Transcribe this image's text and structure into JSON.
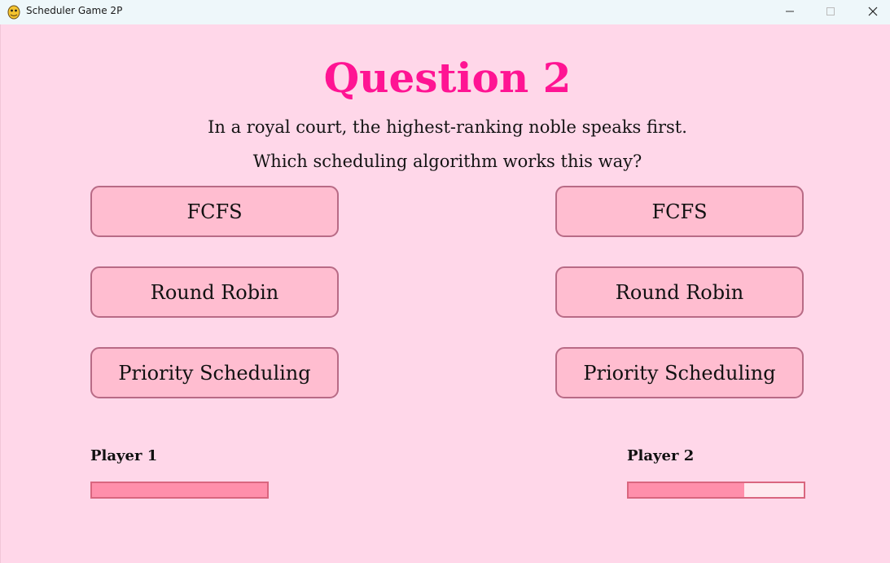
{
  "window": {
    "title": "Scheduler Game 2P",
    "app_icon": "pygame-snake-icon",
    "controls": [
      "minimize-icon",
      "maximize-icon",
      "close-icon"
    ]
  },
  "question": {
    "title": "Question 2",
    "line1": "In a royal court, the highest-ranking noble speaks first.",
    "line2": "Which scheduling algorithm works this way?"
  },
  "options_left": [
    {
      "label": "FCFS"
    },
    {
      "label": "Round Robin"
    },
    {
      "label": "Priority Scheduling"
    }
  ],
  "options_right": [
    {
      "label": "FCFS"
    },
    {
      "label": "Round Robin"
    },
    {
      "label": "Priority Scheduling"
    }
  ],
  "players": [
    {
      "label": "Player 1",
      "progress": 1.0
    },
    {
      "label": "Player 2",
      "progress": 0.66
    }
  ],
  "colors": {
    "background": "#ffd7e9",
    "title": "#ff1493",
    "button_fill": "#ffbdd0",
    "button_border": "#b86b86",
    "progress_fill": "#ff8fab",
    "progress_empty": "#ffe9ef",
    "progress_border": "#d9667f"
  }
}
